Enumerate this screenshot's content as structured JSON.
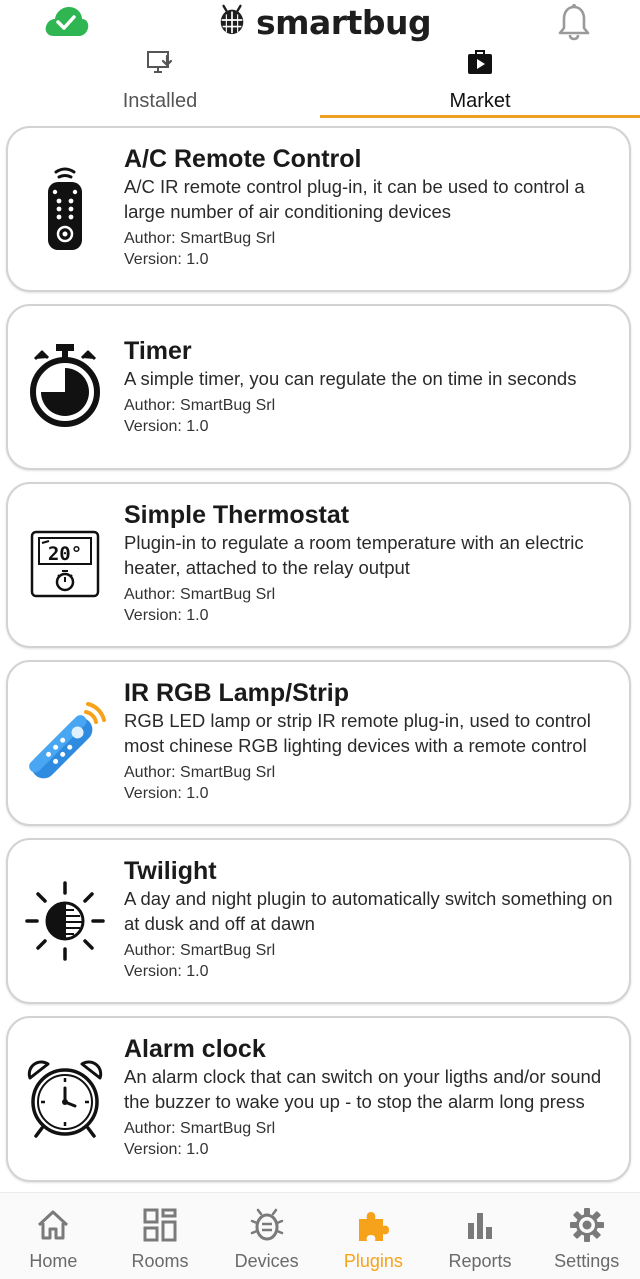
{
  "header": {
    "logo_text": "smartbug",
    "cloud_status_color": "#2fb552",
    "cloud_icon": "cloud-check-icon",
    "notification_icon": "bell-icon"
  },
  "tabs": [
    {
      "label": "Installed",
      "icon": "download-to-screen-icon",
      "active": false
    },
    {
      "label": "Market",
      "icon": "store-bag-icon",
      "active": true
    }
  ],
  "accent_color": "#f7a21b",
  "plugins": [
    {
      "title": "A/C Remote Control",
      "description": "A/C IR remote control plug-in, it can be used to control a large number of air conditioning devices",
      "author": "Author: SmartBug Srl",
      "version": "Version: 1.0",
      "icon": "ac-remote-icon"
    },
    {
      "title": "Timer",
      "description": "A simple timer, you can regulate the on time in seconds",
      "author": "Author: SmartBug Srl",
      "version": "Version: 1.0",
      "icon": "stopwatch-icon"
    },
    {
      "title": "Simple Thermostat",
      "description": "Plugin-in to regulate a room temperature with an electric heater, attached to the relay output",
      "author": "Author: SmartBug Srl",
      "version": "Version: 1.0",
      "icon": "thermostat-icon",
      "icon_text": "20°"
    },
    {
      "title": "IR RGB Lamp/Strip",
      "description": "RGB LED lamp or strip IR remote plug-in, used to control most chinese RGB lighting devices with a remote control",
      "author": "Author: SmartBug Srl",
      "version": "Version: 1.0",
      "icon": "rgb-remote-icon"
    },
    {
      "title": "Twilight",
      "description": "A day and night plugin to automatically switch something on at dusk and off at dawn",
      "author": "Author: SmartBug Srl",
      "version": "Version: 1.0",
      "icon": "day-night-icon"
    },
    {
      "title": "Alarm clock",
      "description": "An alarm clock that can switch on your ligths and/or sound the buzzer to wake you up - to stop the alarm long press",
      "author": "Author: SmartBug Srl",
      "version": "Version: 1.0",
      "icon": "alarm-clock-icon"
    }
  ],
  "bottom_nav": [
    {
      "label": "Home",
      "icon": "home-icon",
      "active": false
    },
    {
      "label": "Rooms",
      "icon": "rooms-grid-icon",
      "active": false
    },
    {
      "label": "Devices",
      "icon": "bug-device-icon",
      "active": false
    },
    {
      "label": "Plugins",
      "icon": "puzzle-icon",
      "active": true
    },
    {
      "label": "Reports",
      "icon": "bar-chart-icon",
      "active": false
    },
    {
      "label": "Settings",
      "icon": "gear-icon",
      "active": false
    }
  ]
}
